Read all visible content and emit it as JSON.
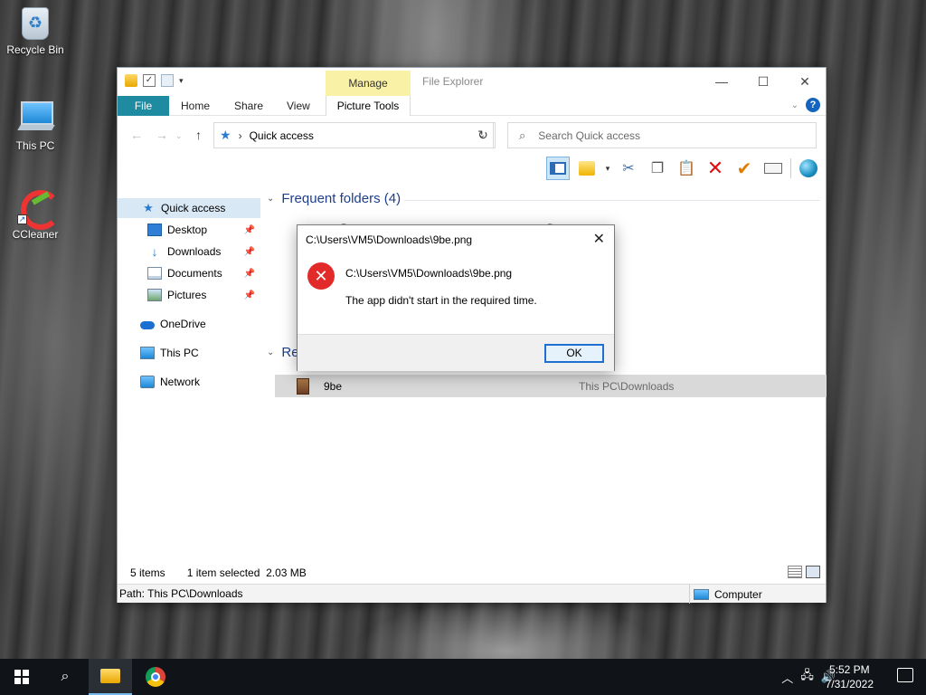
{
  "desktop": {
    "icons": [
      {
        "label": "Recycle Bin"
      },
      {
        "label": "This PC"
      },
      {
        "label": "CCleaner"
      }
    ]
  },
  "explorer": {
    "title": "File Explorer",
    "contextual_group": "Manage",
    "ribbon_tabs": {
      "file": "File",
      "home": "Home",
      "share": "Share",
      "view": "View",
      "picture_tools": "Picture Tools"
    },
    "window_buttons": {
      "minimize": "—",
      "maximize": "☐",
      "close": "✕"
    },
    "address": {
      "location": "Quick access",
      "separator": "›"
    },
    "search": {
      "placeholder": "Search Quick access"
    },
    "nav_pane": {
      "items": [
        {
          "label": "Quick access",
          "icon": "star-icon"
        },
        {
          "label": "Desktop",
          "icon": "desktop-icon",
          "pinned": true
        },
        {
          "label": "Downloads",
          "icon": "download-icon",
          "pinned": true
        },
        {
          "label": "Documents",
          "icon": "documents-icon",
          "pinned": true
        },
        {
          "label": "Pictures",
          "icon": "pictures-icon",
          "pinned": true
        },
        {
          "label": "OneDrive",
          "icon": "cloud-icon"
        },
        {
          "label": "This PC",
          "icon": "computer-icon"
        },
        {
          "label": "Network",
          "icon": "network-icon"
        }
      ]
    },
    "content": {
      "frequent_header": "Frequent folders (4)",
      "frequent_col1_partial": "D",
      "frequent_col2_partial": "D",
      "recent_header_partial": "Re",
      "recent_file": {
        "name": "9be",
        "location": "This PC\\Downloads"
      }
    },
    "status": {
      "items": "5 items",
      "selected": "1 item selected",
      "size": "2.03 MB"
    },
    "pathbar": {
      "path": "Path: This PC\\Downloads",
      "computer": "Computer"
    }
  },
  "dialog": {
    "title": "C:\\Users\\VM5\\Downloads\\9be.png",
    "message_path": "C:\\Users\\VM5\\Downloads\\9be.png",
    "message": "The app didn't start in the required time.",
    "ok_label": "OK",
    "close_glyph": "✕",
    "error_glyph": "✕"
  },
  "taskbar": {
    "time": "5:52 PM",
    "date": "7/31/2022"
  },
  "colors": {
    "file_tab": "#1e8ba0",
    "manage_tab": "#f9f1a5",
    "error_red": "#e22a2a",
    "accent_blue": "#1f6fd0"
  }
}
